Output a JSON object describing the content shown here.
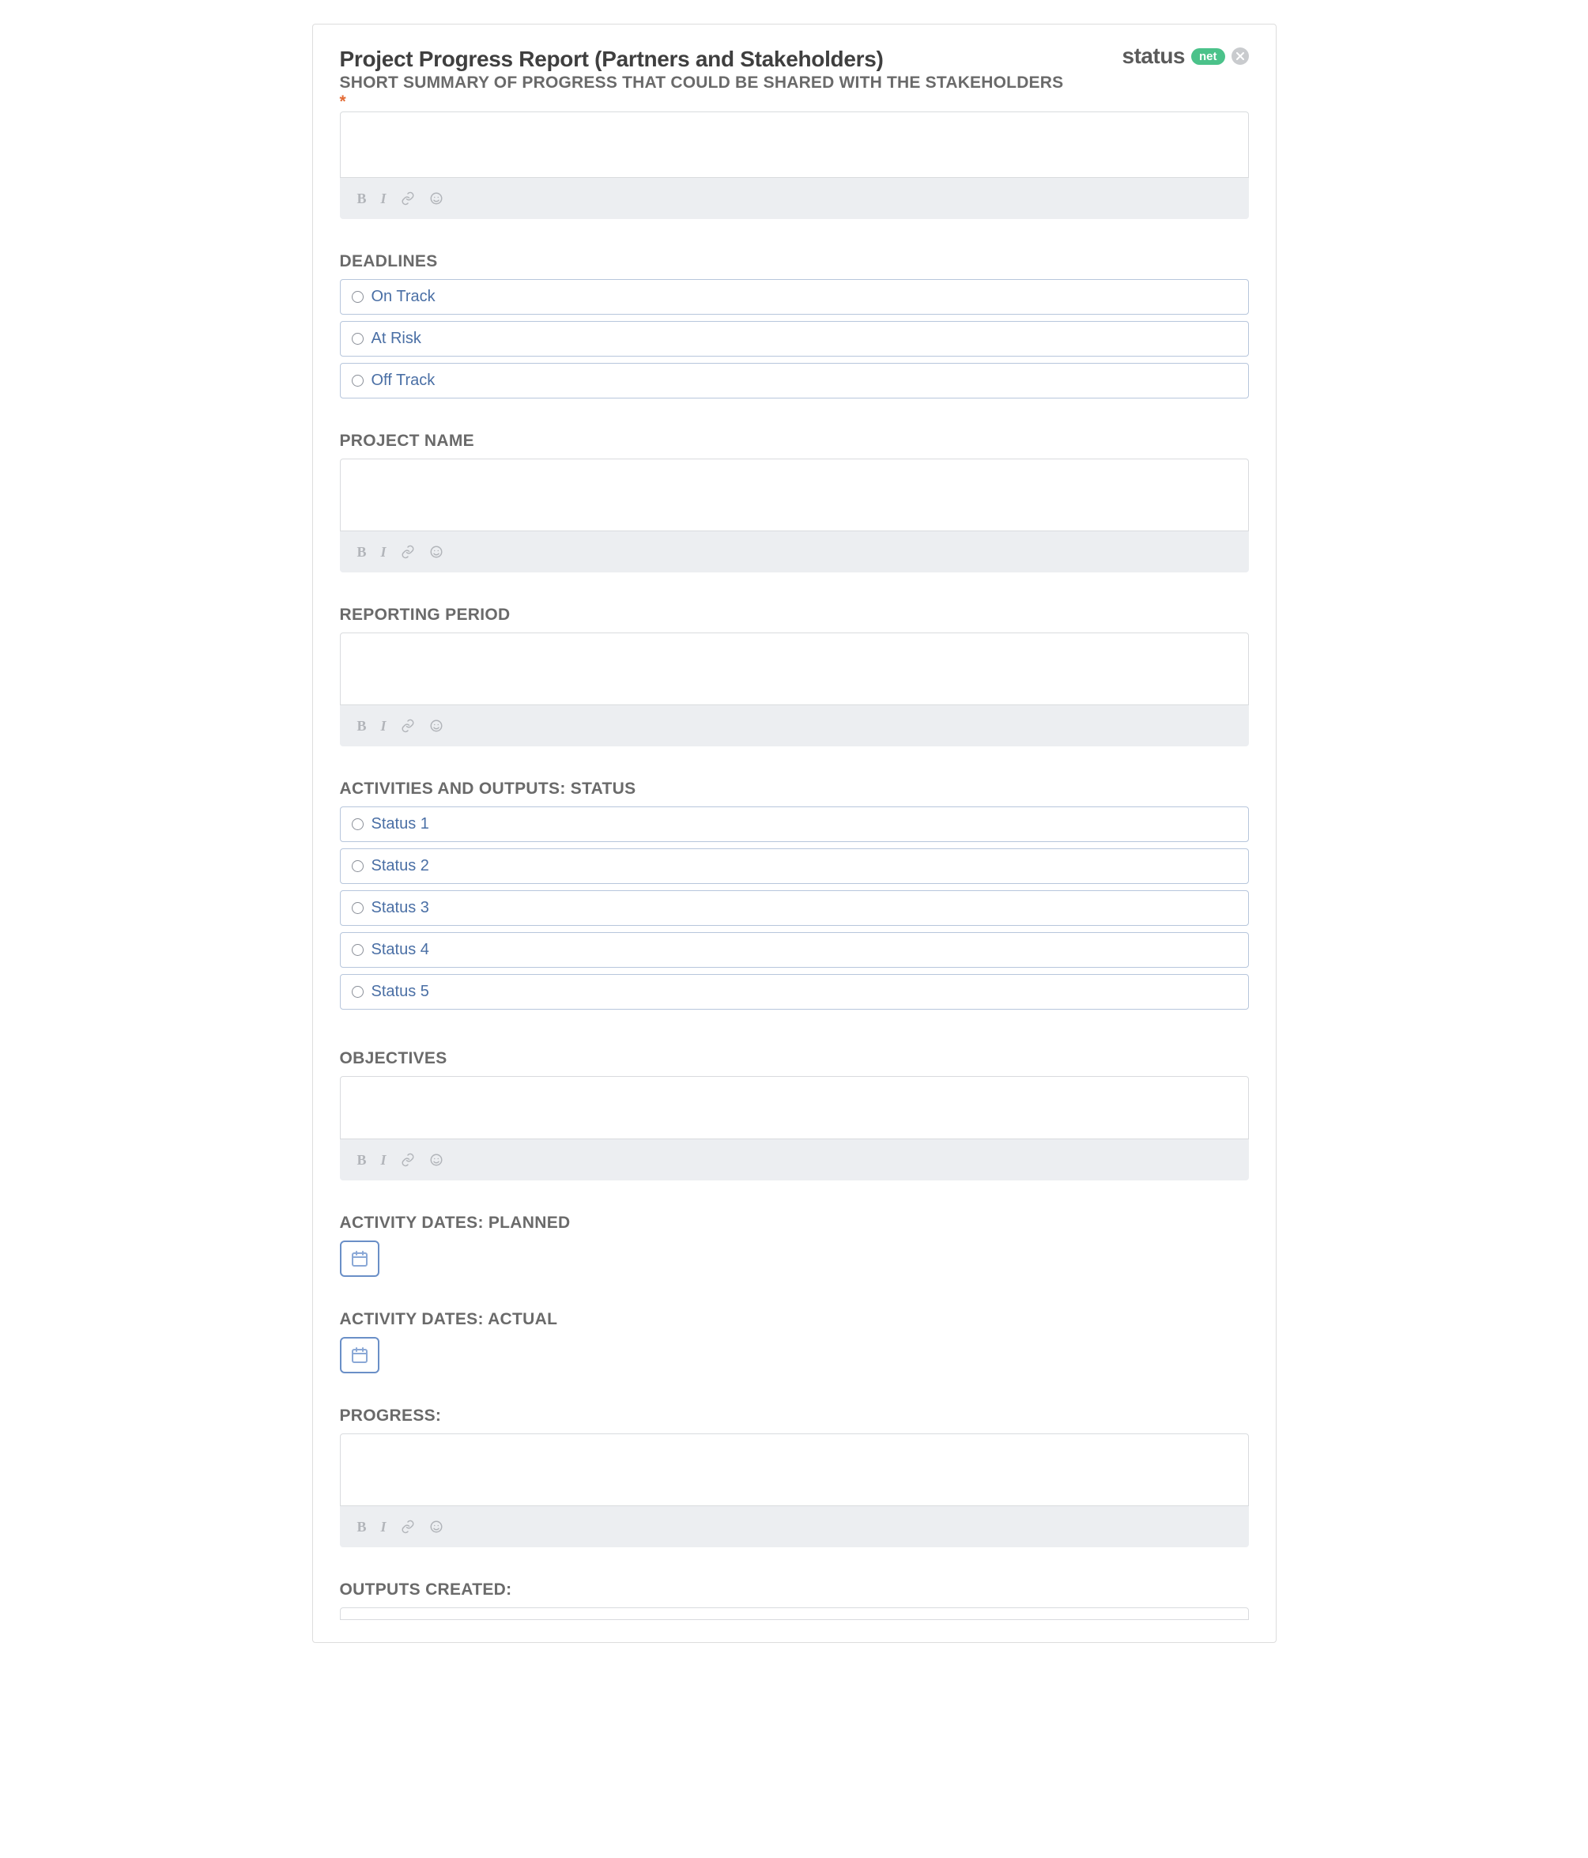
{
  "header": {
    "title": "Project Progress Report (Partners and Stakeholders)",
    "logo_text": "status",
    "logo_badge": "net"
  },
  "sections": {
    "summary": {
      "label": "SHORT SUMMARY OF PROGRESS THAT COULD BE SHARED WITH THE STAKEHOLDERS",
      "required": "*"
    },
    "deadlines": {
      "label": "DEADLINES",
      "options": [
        "On Track",
        "At Risk",
        "Off Track"
      ]
    },
    "project_name": {
      "label": "PROJECT NAME"
    },
    "reporting_period": {
      "label": "REPORTING PERIOD"
    },
    "activities_status": {
      "label": "ACTIVITIES AND OUTPUTS: STATUS",
      "options": [
        "Status 1",
        "Status 2",
        "Status 3",
        "Status 4",
        "Status 5"
      ]
    },
    "objectives": {
      "label": "OBJECTIVES"
    },
    "activity_planned": {
      "label": "ACTIVITY DATES: PLANNED"
    },
    "activity_actual": {
      "label": "ACTIVITY DATES: ACTUAL"
    },
    "progress": {
      "label": "PROGRESS:"
    },
    "outputs_created": {
      "label": "OUTPUTS CREATED:"
    }
  },
  "toolbar": {
    "bold": "B",
    "italic": "I"
  }
}
